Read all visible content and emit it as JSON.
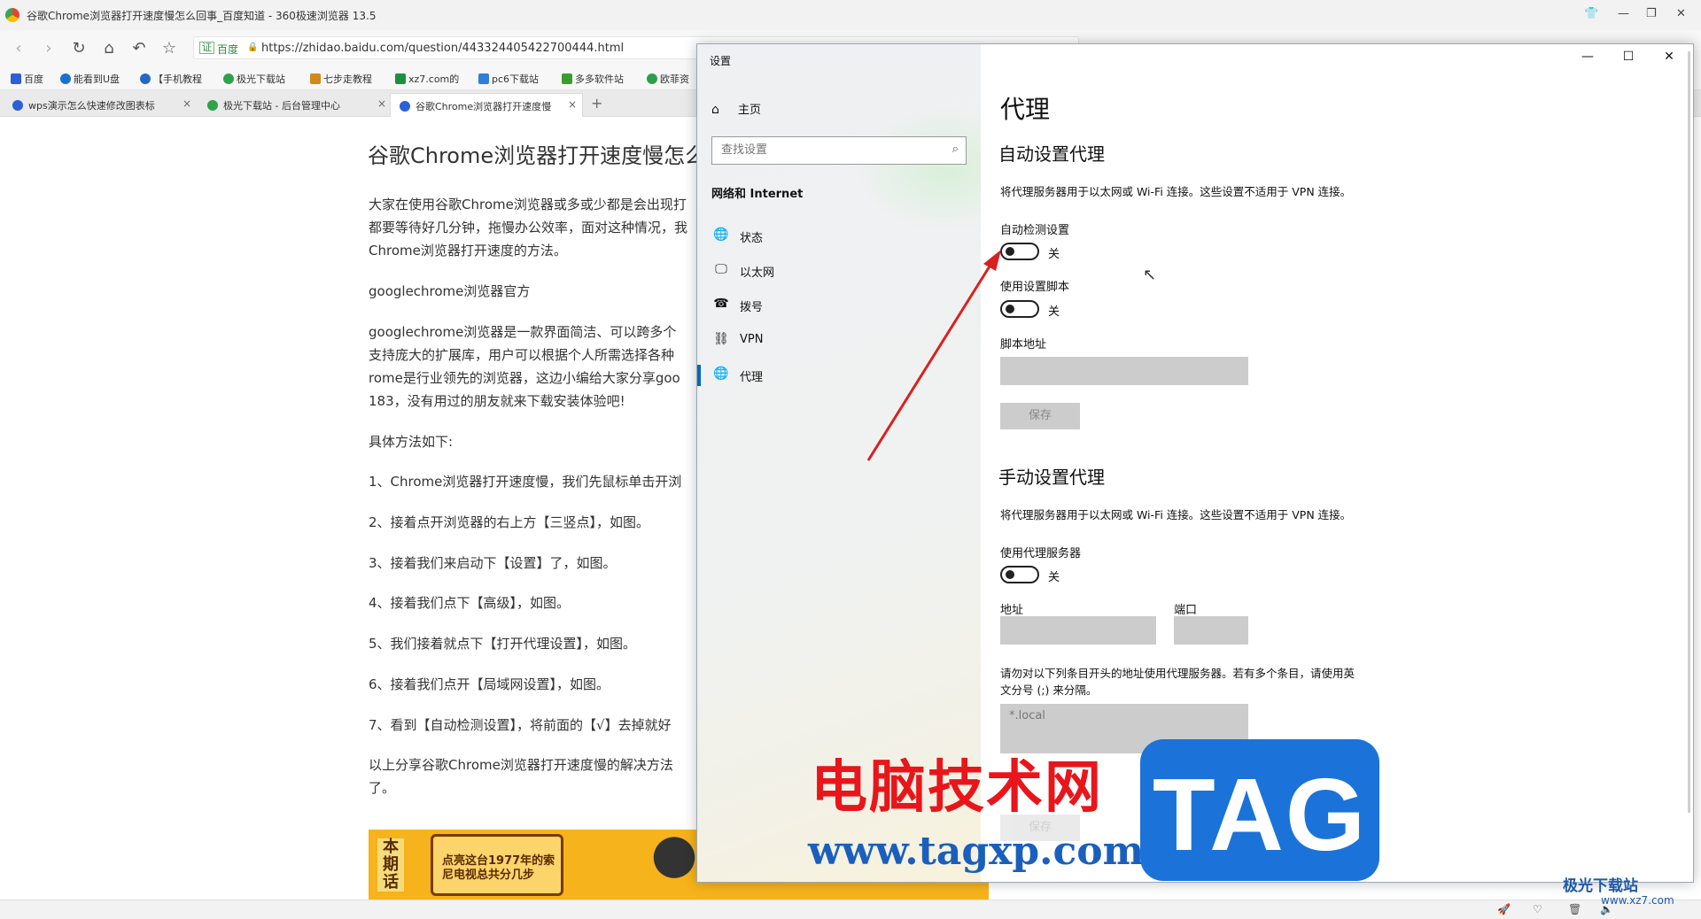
{
  "browser": {
    "window_title": "谷歌Chrome浏览器打开速度慢怎么回事_百度知道 - 360极速浏览器 13.5",
    "url_badge": "证",
    "url_site": "百度",
    "url": "https://zhidao.baidu.com/question/443324405422700444.html",
    "bookmarks": [
      {
        "label": "百度",
        "color": "#2c5fd8"
      },
      {
        "label": "能看到U盘",
        "color": "#1c6fd1"
      },
      {
        "label": "【手机教程",
        "color": "#2468c4"
      },
      {
        "label": "极光下载站",
        "color": "#2fa24b"
      },
      {
        "label": "七步走教程",
        "color": "#d18a1a"
      },
      {
        "label": "xz7.com的",
        "color": "#1e8f3c"
      },
      {
        "label": "pc6下载站",
        "color": "#2f7ddc"
      },
      {
        "label": "多多软件站",
        "color": "#3b9d2e"
      },
      {
        "label": "欧菲资",
        "color": "#2aa04a"
      }
    ],
    "tabs": [
      {
        "label": "wps演示怎么快速修改图表标",
        "close": "×"
      },
      {
        "label": "极光下载站 - 后台管理中心",
        "close": "×"
      },
      {
        "label": "谷歌Chrome浏览器打开速度慢",
        "close": "×"
      }
    ],
    "new_tab": "+"
  },
  "article": {
    "title": "谷歌Chrome浏览器打开速度慢怎么回事",
    "paragraphs": [
      "大家在使用谷歌Chrome浏览器或多或少都是会出现打",
      "都要等待好几分钟，拖慢办公效率，面对这种情况，我",
      "Chrome浏览器打开速度的方法。",
      "googlechrome浏览器官方",
      "googlechrome浏览器是一款界面简洁、可以跨多个",
      "支持庞大的扩展库，用户可以根据个人所需选择各种",
      "rome是行业领先的浏览器，这边小编给大家分享goo",
      "183，没有用过的朋友就来下载安装体验吧!",
      "具体方法如下:",
      "1、Chrome浏览器打开速度慢，我们先鼠标单击开浏",
      "2、接着点开浏览器的右上方【三竖点】，如图。",
      "3、接着我们来启动下【设置】了，如图。",
      "4、接着我们点下【高级】，如图。",
      "5、我们接着就点下【打开代理设置】，如图。",
      "6、接着我们点开【局域网设置】，如图。",
      "7、看到【自动检测设置】，将前面的【√】去掉就好",
      "以上分享谷歌Chrome浏览器打开速度慢的解决方法",
      "了。"
    ],
    "banner_side": "本期话",
    "banner_text": "点亮这台1977年的索尼电视总共分几步"
  },
  "settings": {
    "window_title": "设置",
    "home": "主页",
    "search_placeholder": "查找设置",
    "section": "网络和 Internet",
    "nav": [
      {
        "label": "状态",
        "icon": "globe-status-icon",
        "glyph": "🌐"
      },
      {
        "label": "以太网",
        "icon": "ethernet-icon",
        "glyph": "🖵"
      },
      {
        "label": "拨号",
        "icon": "dialup-icon",
        "glyph": "☎"
      },
      {
        "label": "VPN",
        "icon": "vpn-icon",
        "glyph": "⛓"
      },
      {
        "label": "代理",
        "icon": "proxy-globe-icon",
        "glyph": "🌐"
      }
    ],
    "page_title": "代理",
    "auto": {
      "heading": "自动设置代理",
      "desc": "将代理服务器用于以太网或 Wi-Fi 连接。这些设置不适用于 VPN 连接。",
      "detect_label": "自动检测设置",
      "detect_state": "关",
      "script_label": "使用设置脚本",
      "script_state": "关",
      "address_label": "脚本地址",
      "address_value": "",
      "save": "保存"
    },
    "manual": {
      "heading": "手动设置代理",
      "desc": "将代理服务器用于以太网或 Wi-Fi 连接。这些设置不适用于 VPN 连接。",
      "use_label": "使用代理服务器",
      "use_state": "关",
      "address_label": "地址",
      "port_label": "端口",
      "exceptions_line1": "请勿对以下列条目开头的地址使用代理服务器。若有多个条目，请使用英",
      "exceptions_line2": "文分号 (;) 来分隔。",
      "exceptions_value": "*.local",
      "save": "保存"
    }
  },
  "watermarks": {
    "cn": "电脑技术网",
    "url": "www.tagxp.com",
    "tag": "TAG",
    "corner_logo": "极光下载站",
    "corner_url": "www.xz7.com"
  },
  "colors": {
    "accent": "#0067c0",
    "arrow": "#d9211f",
    "tag_blue": "#1b73d9",
    "watermark_red": "#e8161b"
  }
}
